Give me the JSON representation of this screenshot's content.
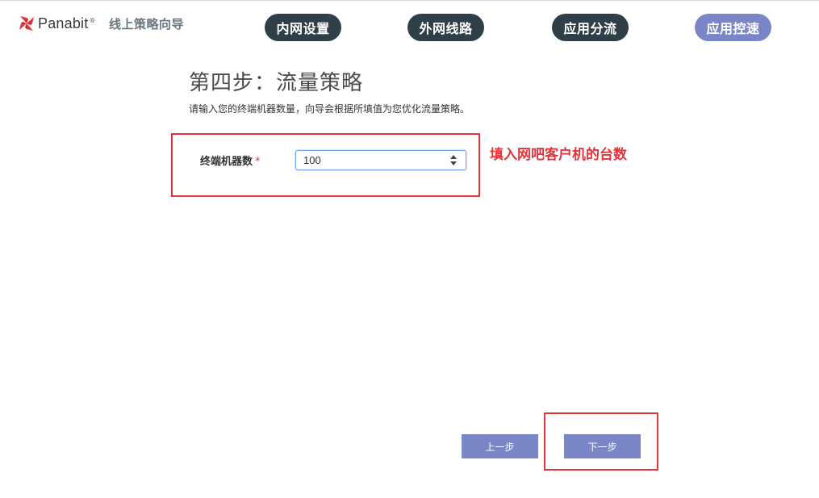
{
  "header": {
    "brand": "Panabit",
    "brand_mark": "®",
    "wizard_title": "线上策略向导",
    "steps": [
      {
        "label": "内网设置",
        "state": "done"
      },
      {
        "label": "外网线路",
        "state": "done"
      },
      {
        "label": "应用分流",
        "state": "done"
      },
      {
        "label": "应用控速",
        "state": "active"
      }
    ]
  },
  "main": {
    "title": "第四步：流量策略",
    "description": "请输入您的终端机器数量，向导会根据所填值为您优化流量策略。",
    "field": {
      "label": "终端机器数",
      "required_mark": "*",
      "value": "100"
    },
    "annotation": "填入网吧客户机的台数"
  },
  "footer": {
    "prev_label": "上一步",
    "next_label": "下一步"
  },
  "colors": {
    "step_done": "#2f3f47",
    "step_active": "#7b86c6",
    "button": "#7b86c6",
    "annotation": "#e5333a",
    "logo_red": "#e5333a"
  },
  "icons": {
    "logo": "pinwheel-logo-icon",
    "spinner": "number-spinner-icon"
  }
}
